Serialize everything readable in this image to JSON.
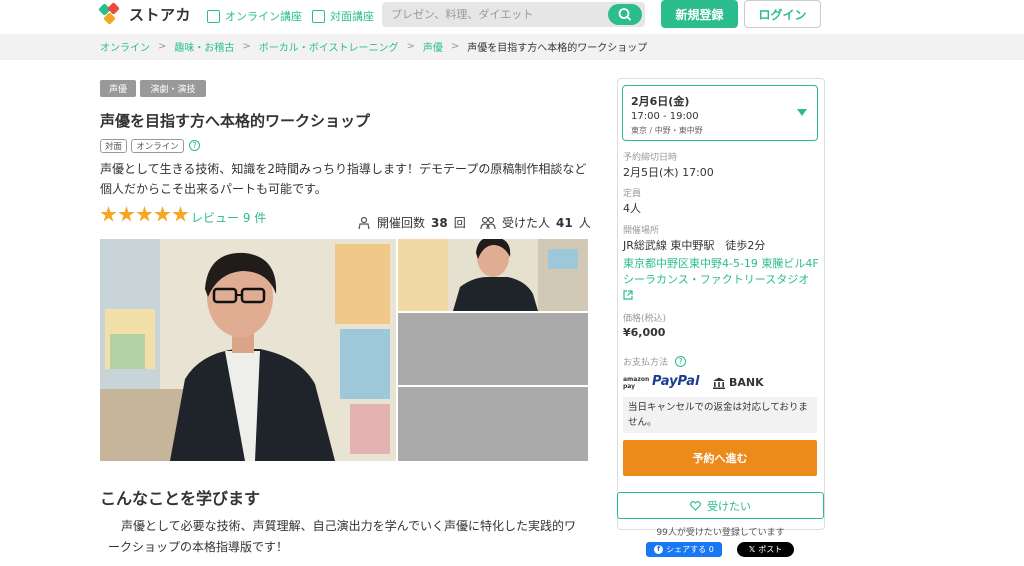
{
  "header": {
    "logo_text": "ストアカ",
    "nav": [
      {
        "label": "オンライン講座",
        "icon": "online-class-icon"
      },
      {
        "label": "対面講座",
        "icon": "in-person-class-icon"
      }
    ],
    "search_placeholder": "プレゼン、料理、ダイエット",
    "register_label": "新規登録",
    "login_label": "ログイン"
  },
  "breadcrumb": {
    "items": [
      "オンライン",
      "趣味・お稽古",
      "ボーカル・ボイストレーニング",
      "声優"
    ],
    "current": "声優を目指す方へ本格的ワークショップ"
  },
  "course": {
    "tags": [
      "声優",
      "演劇・演技"
    ],
    "title": "声優を目指す方へ本格的ワークショップ",
    "formats": [
      "対面",
      "オンライン"
    ],
    "description": "声優として生きる技術、知識を2時間みっちり指導します！デモテープの原稿制作相談など個人だからこそ出来るパートも可能です。",
    "rating_stars": 5,
    "review_text": "レビュー 9 件",
    "held_label": "開催回数",
    "held_count": "38",
    "held_unit": "回",
    "attended_label": "受けた人",
    "attended_count": "41",
    "attended_unit": "人"
  },
  "learn": {
    "heading": "こんなことを学びます",
    "text": "声優として必要な技術、声質理解、自己演出力を学んでいく声優に特化した実践的ワークショップの本格指導版です！"
  },
  "sidebar": {
    "date": "2月6日(金)",
    "time": "17:00 - 19:00",
    "location_short": "東京 / 中野・東中野",
    "deadline_label": "予約締切日時",
    "deadline_value": "2月5日(木) 17:00",
    "capacity_label": "定員",
    "capacity_value": "4人",
    "venue_label": "開催場所",
    "venue_station": "JR総武線 東中野駅　徒歩2分",
    "venue_address": "東京都中野区東中野4-5-19 東騰ビル4F",
    "venue_name": "シーラカンス・ファクトリースタジオ",
    "price_label": "価格(税込)",
    "price_value": "¥6,000",
    "payment_label": "お支払方法",
    "amazon_label": "amazon pay",
    "paypal_label": "PayPal",
    "bank_label": "BANK",
    "cancel_notice": "当日キャンセルでの返金は対応しておりません。",
    "reserve_label": "予約へ進む",
    "want_label": "受けたい",
    "want_count": "99人が受けたい登録しています",
    "share_fb": "シェアする 0",
    "share_x": "ポスト"
  },
  "colors": {
    "brand": "#2bbd8e",
    "reserve": "#ec8a1a",
    "star": "#f5a623"
  }
}
